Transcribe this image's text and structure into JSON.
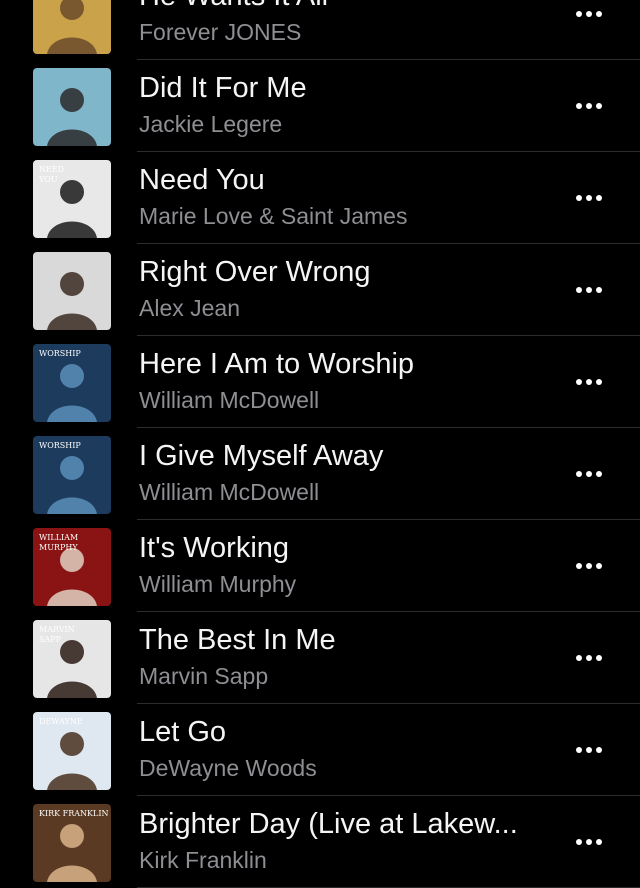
{
  "songs": [
    {
      "title": "He Wants It All",
      "artist": "Forever JONES",
      "art_bg": "#c9a24a",
      "art_fg": "#6b4a2a"
    },
    {
      "title": "Did It For Me",
      "artist": "Jackie Legere",
      "art_bg": "#7fb6c9",
      "art_fg": "#2a2a2a"
    },
    {
      "title": "Need You",
      "artist": "Marie Love & Saint James",
      "art_bg": "#e8e8e8",
      "art_fg": "#1a1a1a",
      "art_text": [
        "NEED",
        "YOU"
      ]
    },
    {
      "title": "Right Over Wrong",
      "artist": "Alex Jean",
      "art_bg": "#d9d9d9",
      "art_fg": "#3a2a22"
    },
    {
      "title": "Here I Am to Worship",
      "artist": "William McDowell",
      "art_bg": "#1d3b5c",
      "art_fg": "#5a8fb8",
      "art_text": [
        "WORSHIP"
      ]
    },
    {
      "title": "I Give Myself Away",
      "artist": "William McDowell",
      "art_bg": "#1d3b5c",
      "art_fg": "#5a8fb8",
      "art_text": [
        "WORSHIP"
      ]
    },
    {
      "title": "It's Working",
      "artist": "William Murphy",
      "art_bg": "#8a1414",
      "art_fg": "#e0d0c0",
      "art_text": [
        "WILLIAM",
        "MURPHY"
      ]
    },
    {
      "title": "The Best In Me",
      "artist": "Marvin Sapp",
      "art_bg": "#e6e6e6",
      "art_fg": "#2a1a14",
      "art_text": [
        "MARVIN",
        "SAPP"
      ]
    },
    {
      "title": "Let Go",
      "artist": "DeWayne Woods",
      "art_bg": "#dfe8f0",
      "art_fg": "#4a3020",
      "art_text": [
        "DEWAYNE"
      ]
    },
    {
      "title": "Brighter Day (Live at Lakew...",
      "artist": "Kirk Franklin",
      "art_bg": "#5a3a22",
      "art_fg": "#d9b48a",
      "art_text": [
        "KIRK FRANKLIN"
      ]
    }
  ],
  "icons": {
    "more": "ellipsis-horizontal-icon"
  }
}
